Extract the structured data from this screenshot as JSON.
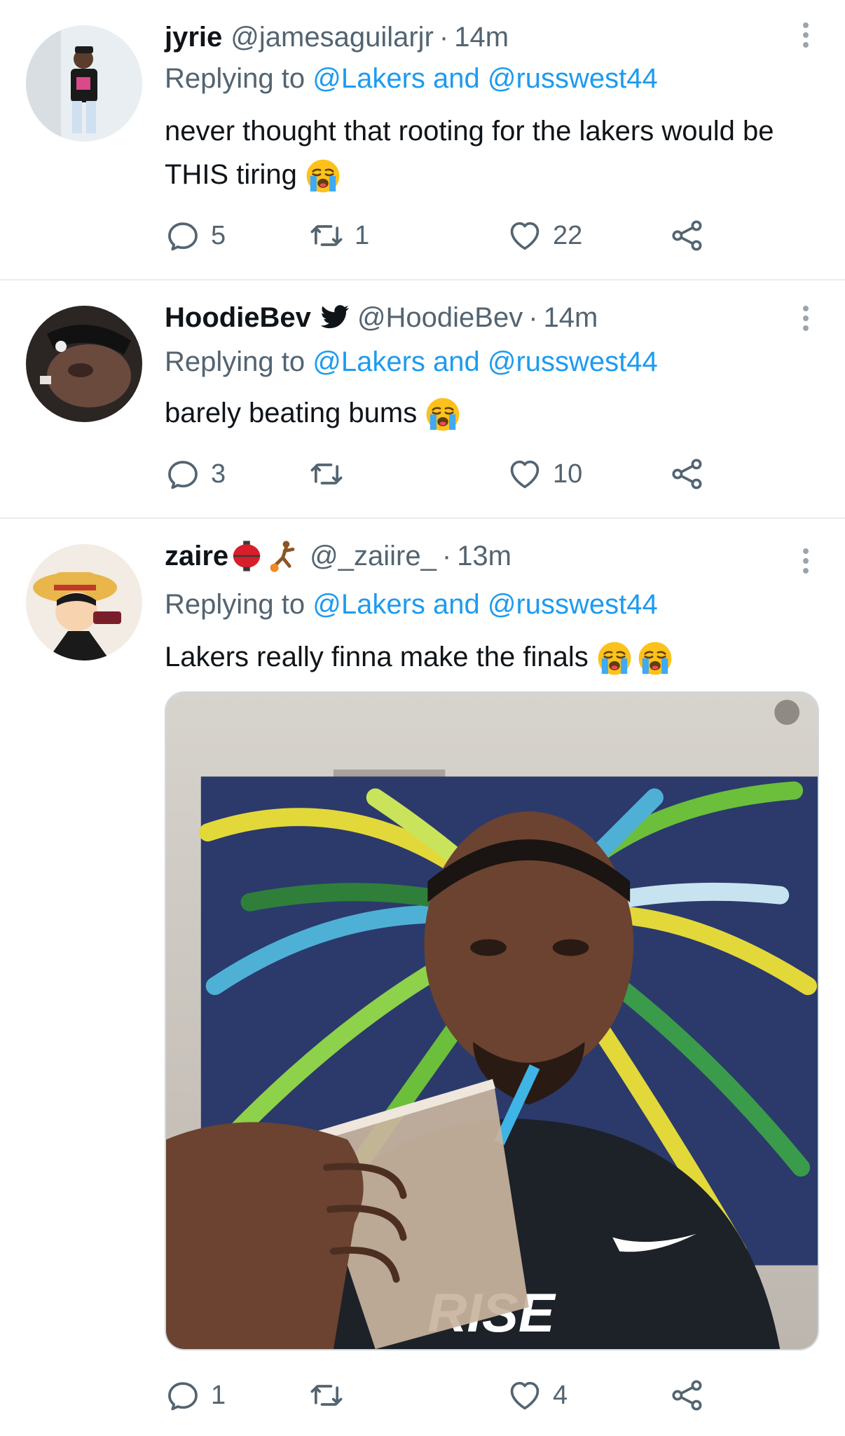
{
  "tweets": [
    {
      "name": "jyrie",
      "handle": "@jamesaguilarjr",
      "separator": "·",
      "time": "14m",
      "replying_prefix": "Replying to ",
      "mention1": "@Lakers",
      "reply_and": " and ",
      "mention2": "@russwest44",
      "text": "never thought that rooting for the lakers would be THIS tiring",
      "replies": "5",
      "retweets": "1",
      "likes": "22"
    },
    {
      "name": "HoodieBev",
      "handle": "@HoodieBev",
      "separator": "·",
      "time": "14m",
      "replying_prefix": "Replying to ",
      "mention1": "@Lakers",
      "reply_and": " and ",
      "mention2": "@russwest44",
      "text": "barely beating bums",
      "replies": "3",
      "retweets": "",
      "likes": "10"
    },
    {
      "name": "zaire",
      "handle": "@_zaiire_",
      "separator": "·",
      "time": "13m",
      "replying_prefix": "Replying to ",
      "mention1": "@Lakers",
      "reply_and": " and ",
      "mention2": "@russwest44",
      "text": "Lakers really finna make the finals",
      "replies": "1",
      "retweets": "",
      "likes": "4",
      "image_shirt_text": "RISE"
    }
  ],
  "icons": {
    "reply": "reply-icon",
    "retweet": "retweet-icon",
    "like": "heart-icon",
    "share": "share-icon",
    "more": "more-icon",
    "emoji": "loudly-crying-face-emoji"
  },
  "colors": {
    "link": "#1d9bf0",
    "secondary_text": "#536471",
    "divider": "#e6ecf0"
  }
}
